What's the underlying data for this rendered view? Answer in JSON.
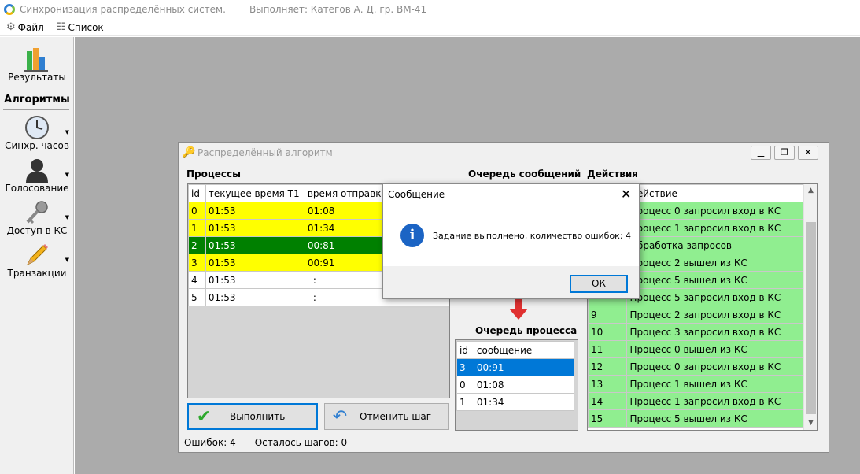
{
  "app": {
    "title": "Синхронизация распределённых систем.",
    "performer": "Выполняет:  Категов А. Д.  гр. ВМ-41"
  },
  "menu": {
    "file": "Файл",
    "list": "Список"
  },
  "sidebar": {
    "results": "Результаты",
    "heading": "Алгоритмы",
    "clock_sync": "Синхр. часов",
    "voting": "Голосование",
    "cs_access": "Доступ в КС",
    "transactions": "Транзакции"
  },
  "child_window": {
    "title": "Распределённый алгоритм",
    "sections": {
      "processes": "Процессы",
      "message_queue": "Очередь сообщений",
      "actions": "Действия",
      "process_queue": "Очередь процесса"
    },
    "proc_headers": [
      "id",
      "текущее время T1",
      "время отправки T"
    ],
    "processes": [
      {
        "id": "0",
        "t1": "01:53",
        "ts": "01:08",
        "style": "yellow"
      },
      {
        "id": "1",
        "t1": "01:53",
        "ts": "01:34",
        "style": "yellow"
      },
      {
        "id": "2",
        "t1": "01:53",
        "ts": "00:81",
        "style": "green"
      },
      {
        "id": "3",
        "t1": "01:53",
        "ts": "00:91",
        "style": "yellow"
      },
      {
        "id": "4",
        "t1": "01:53",
        "ts": ":",
        "style": "white"
      },
      {
        "id": "5",
        "t1": "01:53",
        "ts": ":",
        "style": "white"
      }
    ],
    "queue_headers": [
      "id",
      "сообщение"
    ],
    "queue": [
      {
        "id": "3",
        "msg": "00:91",
        "selected": true
      },
      {
        "id": "0",
        "msg": "01:08",
        "selected": false
      },
      {
        "id": "1",
        "msg": "01:34",
        "selected": false
      }
    ],
    "actions_header": [
      "",
      "Действие"
    ],
    "actions": [
      {
        "n": "",
        "text": "Процесс 0 запросил вход в КС"
      },
      {
        "n": "",
        "text": "Процесс 1 запросил вход в КС"
      },
      {
        "n": "",
        "text": "Обработка запросов"
      },
      {
        "n": "",
        "text": "Процесс 2 вышел из КС"
      },
      {
        "n": "",
        "text": "Процесс 5 вышел из КС"
      },
      {
        "n": "",
        "text": "Процесс 5 запросил вход в КС"
      },
      {
        "n": "9",
        "text": "Процесс 2 запросил вход в КС"
      },
      {
        "n": "10",
        "text": "Процесс 3 запросил вход в КС"
      },
      {
        "n": "11",
        "text": "Процесс 0 вышел из КС"
      },
      {
        "n": "12",
        "text": "Процесс 0 запросил вход в КС"
      },
      {
        "n": "13",
        "text": "Процесс 1 вышел из КС"
      },
      {
        "n": "14",
        "text": "Процесс 1 запросил вход в КС"
      },
      {
        "n": "15",
        "text": "Процесс 5 вышел из КС"
      }
    ],
    "run_button": "Выполнить",
    "undo_button": "Отменить шаг",
    "status": {
      "errors": "Ошибок: 4",
      "steps_left": "Осталось шагов: 0"
    }
  },
  "message_box": {
    "title": "Сообщение",
    "text": "Задание выполнено, количество ошибок: 4",
    "ok": "ОК",
    "icon": "info-icon"
  },
  "colors": {
    "highlight_yellow": "#ffff00",
    "active_green": "#008000",
    "action_green": "#90ee90",
    "selection_blue": "#0078d7"
  }
}
